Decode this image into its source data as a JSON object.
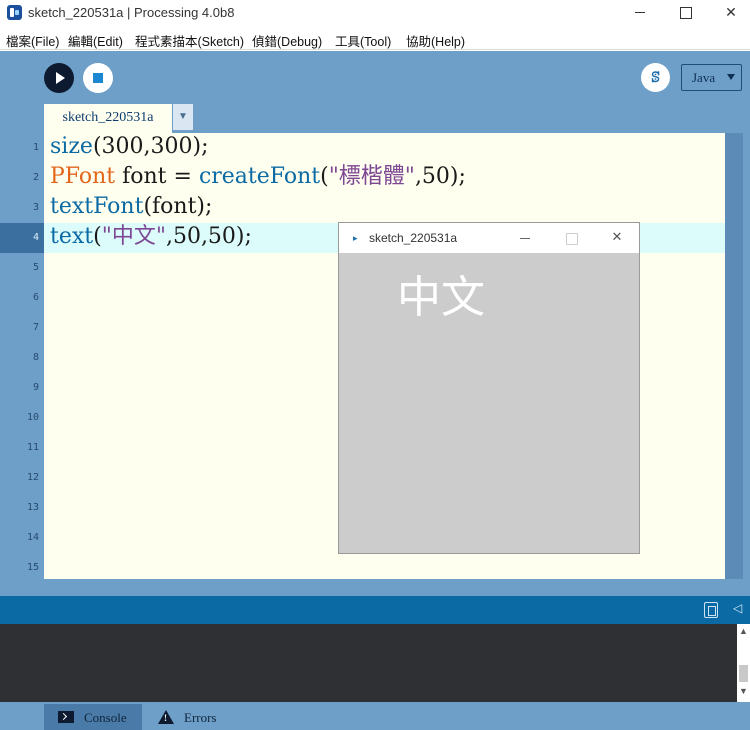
{
  "window": {
    "title": "sketch_220531a | Processing 4.0b8",
    "close_glyph": "✕"
  },
  "menu": {
    "items": [
      "檔案(File)",
      "編輯(Edit)",
      "程式素描本(Sketch)",
      "偵錯(Debug)",
      "工具(Tool)",
      "協助(Help)"
    ]
  },
  "toolbar": {
    "debug_glyph": "ꕷ",
    "mode_label": "Java"
  },
  "tab": {
    "label": "sketch_220531a",
    "menu_glyph": "▼"
  },
  "editor": {
    "line_numbers": [
      "1",
      "2",
      "3",
      "4",
      "5",
      "6",
      "7",
      "8",
      "9",
      "10",
      "11",
      "12",
      "13",
      "14",
      "15"
    ],
    "current_line": 4,
    "lines": [
      {
        "fn": "size",
        "rest": "(300,300);"
      },
      {
        "type": "PFont",
        "middle": " font = ",
        "fn": "createFont",
        "open": "(",
        "str": "\"標楷體\"",
        "rest": ",50);"
      },
      {
        "fn": "textFont",
        "rest": "(font);"
      },
      {
        "fn": "text",
        "open": "(",
        "str": "\"中文\"",
        "rest": ",50,50);"
      }
    ]
  },
  "sketch_window": {
    "title": "sketch_220531a",
    "icon_glyph": "▸",
    "close_glyph": "✕",
    "canvas_text": "中文",
    "canvas_bg": "#cccccc"
  },
  "status": {
    "collapse_glyph": "◁"
  },
  "console": {
    "scroll_up_glyph": "▲",
    "scroll_down_glyph": "▼"
  },
  "footer": {
    "console_label": "Console",
    "errors_label": "Errors"
  },
  "colors": {
    "accent": "#6e9fc8",
    "status_bar": "#0b69a3",
    "editor_bg": "#fffff0",
    "keyword_fn": "#0b6aa4",
    "keyword_type": "#e2661a",
    "string": "#7d4793"
  }
}
